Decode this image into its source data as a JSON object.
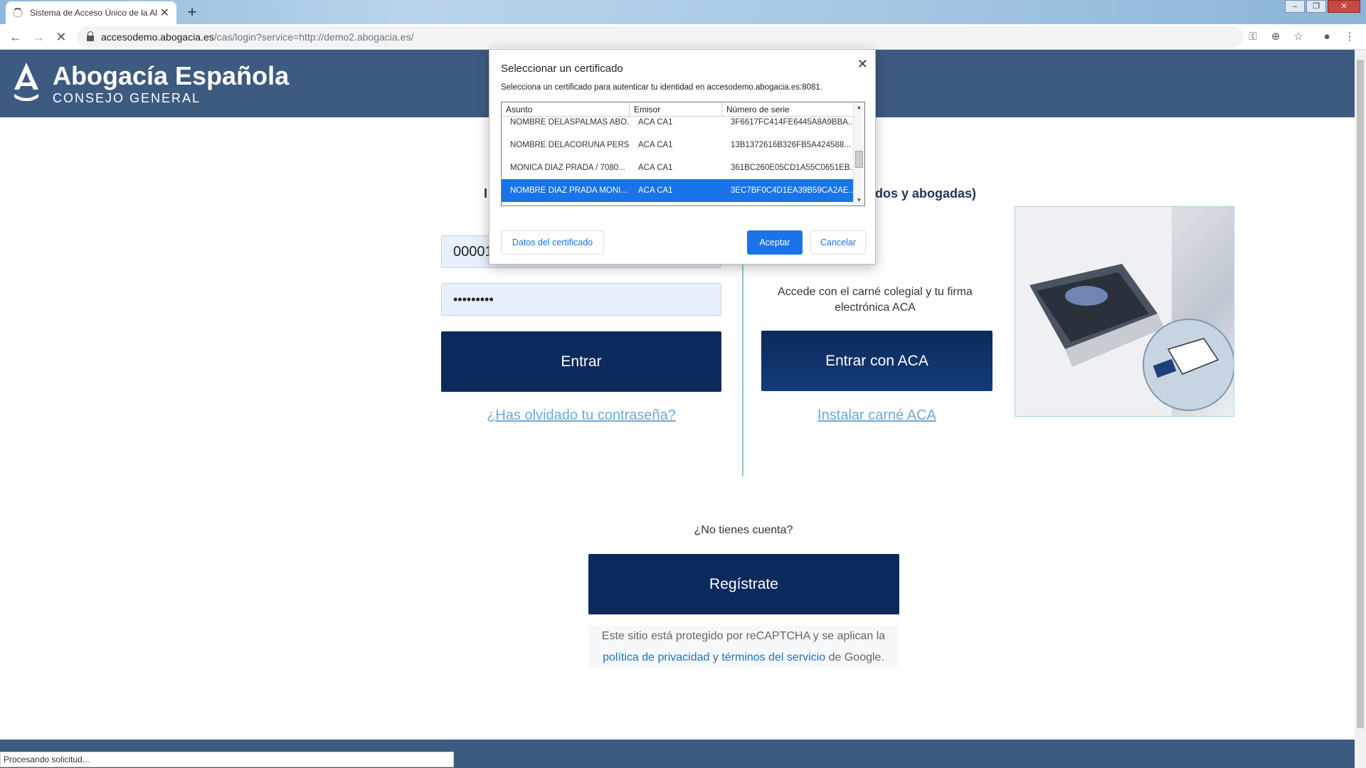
{
  "browser": {
    "tab_title": "Sistema de Acceso Único de la Al",
    "tab_close": "✕",
    "new_tab": "+",
    "url_host": "accesodemo.abogacia.es",
    "url_path": "/cas/login?service=http://demo2.abogacia.es/",
    "status_text": "Procesando solicitud...",
    "icons": [
      "back-icon",
      "forward-icon",
      "stop-icon",
      "lock-icon",
      "key-icon",
      "zoom-icon",
      "star-icon",
      "profile-icon",
      "menu-icon"
    ]
  },
  "header": {
    "title": "Abogacía Española",
    "subtitle": "CONSEJO GENERAL",
    "bg_color": "#3d5a80"
  },
  "login": {
    "partial_heading_left": "I",
    "username_value": "00001",
    "password_value": "•••••••••",
    "submit_label": "Entrar",
    "forgot_link": "¿Has olvidado tu contraseña?"
  },
  "aca": {
    "partial_heading_right": "gados y abogadas)",
    "description": "Accede con el carné colegial y tu firma electrónica ACA",
    "button_label": "Entrar con ACA",
    "install_link": "Instalar carné ACA"
  },
  "register": {
    "question": "¿No tienes cuenta?",
    "button_label": "Regístrate"
  },
  "recaptcha": {
    "line1": "Este sitio está protegido por reCAPTCHA y se aplican la",
    "privacy_link": "política de privacidad",
    "and": "y",
    "terms_link": "términos del servicio",
    "suffix": "de Google."
  },
  "dialog": {
    "title": "Seleccionar un certificado",
    "description": "Selecciona un certificado para autenticar tu identidad en accesodemo.abogacia.es:8081.",
    "columns": [
      "Asunto",
      "Emisor",
      "Número de serie"
    ],
    "rows": [
      {
        "subject": "NOMBRE DELASPALMAS ABO...",
        "issuer": "ACA CA1",
        "serial": "3F6617FC414FE6445A8A9BBA..."
      },
      {
        "subject": "NOMBRE DELACORUÑA PERS...",
        "issuer": "ACA CA1",
        "serial": "13B1372616B326FB5A424588..."
      },
      {
        "subject": "MONICA DIAZ PRADA / 7080...",
        "issuer": "ACA CA1",
        "serial": "361BC260E05CD1A55C0651EB..."
      },
      {
        "subject": "NOMBRE DIAZ PRADA MONI...",
        "issuer": "ACA CA1",
        "serial": "3EC7BF0C4D1EA39B59CA2AE...",
        "selected": true
      }
    ],
    "details_button": "Datos del certificado",
    "accept_button": "Aceptar",
    "cancel_button": "Cancelar",
    "close_icon": "✕",
    "accent_color": "#1a73e8"
  }
}
